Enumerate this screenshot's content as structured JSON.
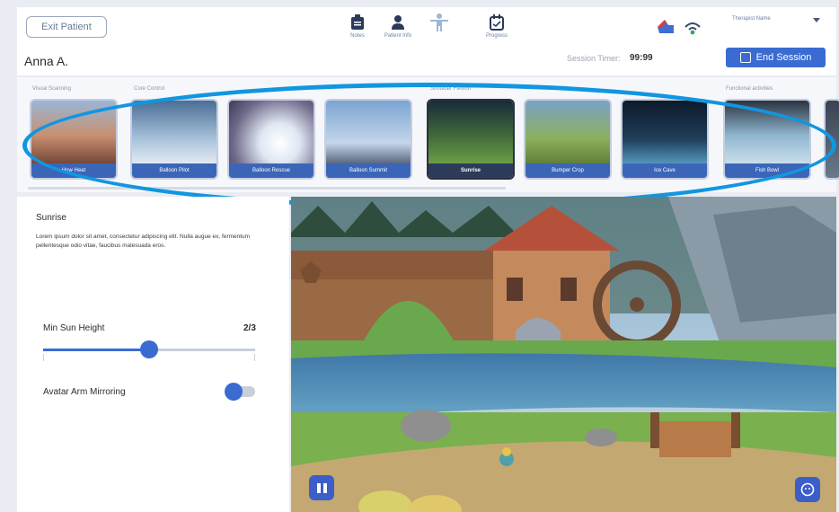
{
  "header": {
    "exit_label": "Exit Patient",
    "patient_name": "Anna A.",
    "nav": [
      {
        "label": "Notes",
        "icon": "notes-icon"
      },
      {
        "label": "Patient Info",
        "icon": "patient-info-icon"
      },
      {
        "label": "",
        "icon": "avatar-icon"
      },
      {
        "label": "Progress",
        "icon": "progress-icon"
      }
    ],
    "session_timer_label": "Session Timer:",
    "session_timer_value": "99:99",
    "end_session_label": "End Session",
    "therapist_name": "Therapist Name"
  },
  "strip": {
    "categories": [
      "Visual Scanning",
      "Core Control",
      "Shoulder Flexion",
      "Functional activities"
    ],
    "cards": [
      {
        "label": "How Heat"
      },
      {
        "label": "Balloon Pilot"
      },
      {
        "label": "Balloon Rescue"
      },
      {
        "label": "Balloon Summit"
      },
      {
        "label": "Sunrise"
      },
      {
        "label": "Bumper Crop"
      },
      {
        "label": "Ice Cave"
      },
      {
        "label": "Fish Bowl"
      }
    ]
  },
  "panel": {
    "title": "Sunrise",
    "description": "Lorem ipsum dolor sit amet, consectetur adipiscing elit. Nulla augue ex, fermentum pellentesque odio vitae, faucibus malesuada eros.",
    "slider_label": "Min Sun Height",
    "slider_value": "2/3",
    "slider_fraction": 0.5,
    "toggle_label": "Avatar Arm Mirroring",
    "toggle_on": false
  },
  "colors": {
    "accent": "#3a6bd1",
    "highlight": "#1196e0"
  }
}
